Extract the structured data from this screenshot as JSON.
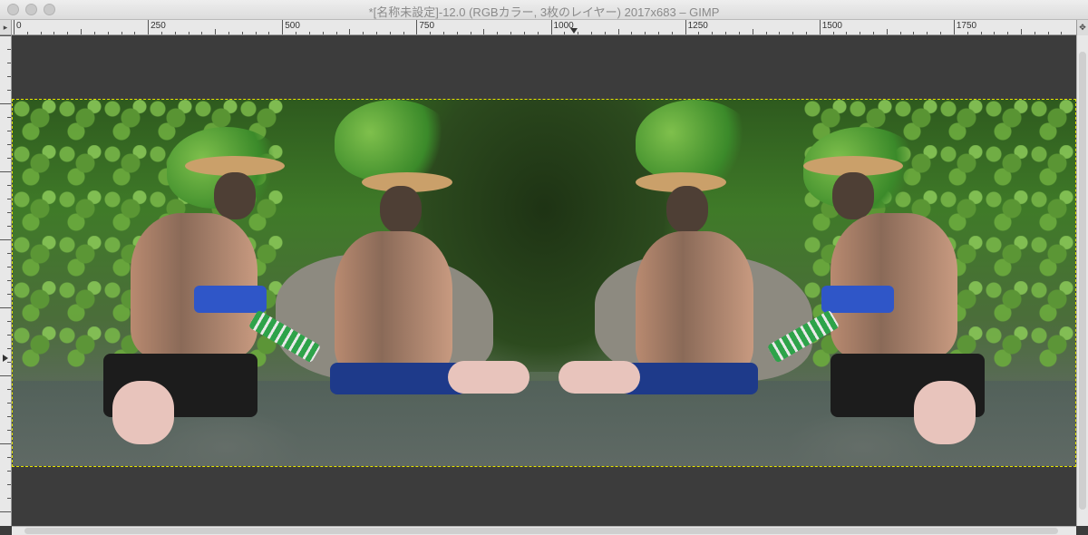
{
  "window": {
    "title": "*[名称未設定]-12.0 (RGBカラー, 3枚のレイヤー) 2017x683 – GIMP"
  },
  "ruler": {
    "labels": [
      "0",
      "250",
      "500",
      "750",
      "1000",
      "1250",
      "1500",
      "1750"
    ]
  },
  "icons": {
    "corner": "menu-arrow-icon",
    "navigate": "navigate-icon",
    "scroll_up": "scroll-up-arrow-icon",
    "scroll_down": "scroll-down-arrow-icon",
    "scroll_left": "scroll-left-arrow-icon",
    "scroll_right": "scroll-right-arrow-icon"
  },
  "colors": {
    "canvas_bg": "#3c3c3c",
    "selection": "#e6e600"
  }
}
